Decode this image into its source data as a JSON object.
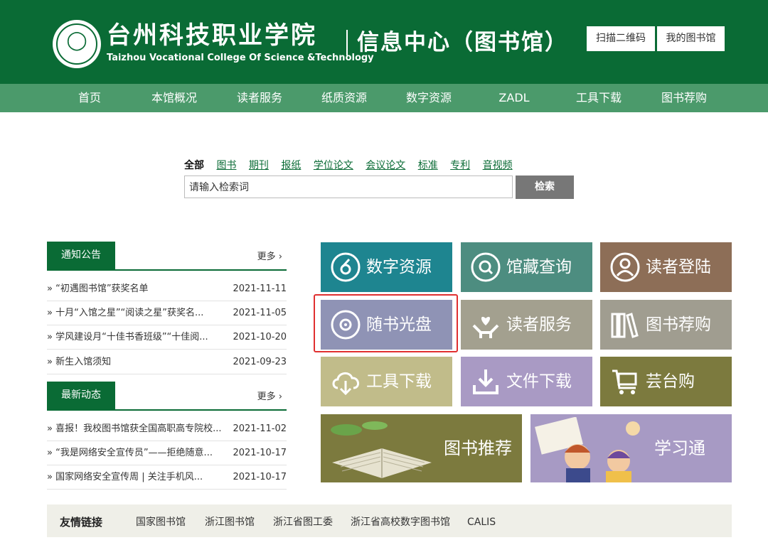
{
  "header": {
    "title_cn": "台州科技职业学院",
    "title_en": "Taizhou Vocational College Of Science &Technology",
    "subtitle": "信息中心（图书馆）",
    "btn_qr": "扫描二维码",
    "btn_mylib": "我的图书馆"
  },
  "nav": [
    "首页",
    "本馆概况",
    "读者服务",
    "纸质资源",
    "数字资源",
    "ZADL",
    "工具下载",
    "图书荐购"
  ],
  "search": {
    "tabs": [
      "全部",
      "图书",
      "期刊",
      "报纸",
      "学位论文",
      "会议论文",
      "标准",
      "专利",
      "音视频"
    ],
    "active_tab": "全部",
    "placeholder": "请输入检索词",
    "button": "检索"
  },
  "notices": {
    "title": "通知公告",
    "more": "更多 ›",
    "items": [
      {
        "title": "» “初遇图书馆”获奖名单",
        "date": "2021-11-11"
      },
      {
        "title": "» 十月“入馆之星”“阅读之星”获奖名...",
        "date": "2021-11-05"
      },
      {
        "title": "» 学风建设月“十佳书香班级”“十佳阅...",
        "date": "2021-10-20"
      },
      {
        "title": "» 新生入馆须知",
        "date": "2021-09-23"
      }
    ]
  },
  "news": {
    "title": "最新动态",
    "more": "更多 ›",
    "items": [
      {
        "title": "» 喜报！我校图书馆获全国高职高专院校...",
        "date": "2021-11-02"
      },
      {
        "title": "» “我是网络安全宣传员”——拒绝随意...",
        "date": "2021-10-17"
      },
      {
        "title": "» 国家网络安全宣传周 | 关注手机风...",
        "date": "2021-10-17"
      }
    ]
  },
  "tiles": [
    {
      "label": "数字资源",
      "icon": "digital-resource-icon",
      "color": "#1e8590"
    },
    {
      "label": "馆藏查询",
      "icon": "search-icon",
      "color": "#4d8d80"
    },
    {
      "label": "读者登陆",
      "icon": "user-icon",
      "color": "#8d6e57"
    },
    {
      "label": "随书光盘",
      "icon": "disc-icon",
      "color": "#8f93b5"
    },
    {
      "label": "读者服务",
      "icon": "heart-hand-icon",
      "color": "#a3a08f"
    },
    {
      "label": "图书荐购",
      "icon": "books-icon",
      "color": "#a09d90"
    },
    {
      "label": "工具下载",
      "icon": "cloud-download-icon",
      "color": "#c1bc8a"
    },
    {
      "label": "文件下载",
      "icon": "download-icon",
      "color": "#a99ac4"
    },
    {
      "label": "芸台购",
      "icon": "cart-icon",
      "color": "#7c7a3e"
    }
  ],
  "banners": [
    {
      "label": "图书推荐",
      "icon": "open-book-icon",
      "color": "#7c7a3e"
    },
    {
      "label": "学习通",
      "icon": "study-illustration-icon",
      "color": "#a79ac4"
    }
  ],
  "links": {
    "title": "友情链接",
    "items": [
      "国家图书馆",
      "浙江图书馆",
      "浙江省图工委",
      "浙江省高校数字图书馆",
      "CALIS"
    ]
  }
}
